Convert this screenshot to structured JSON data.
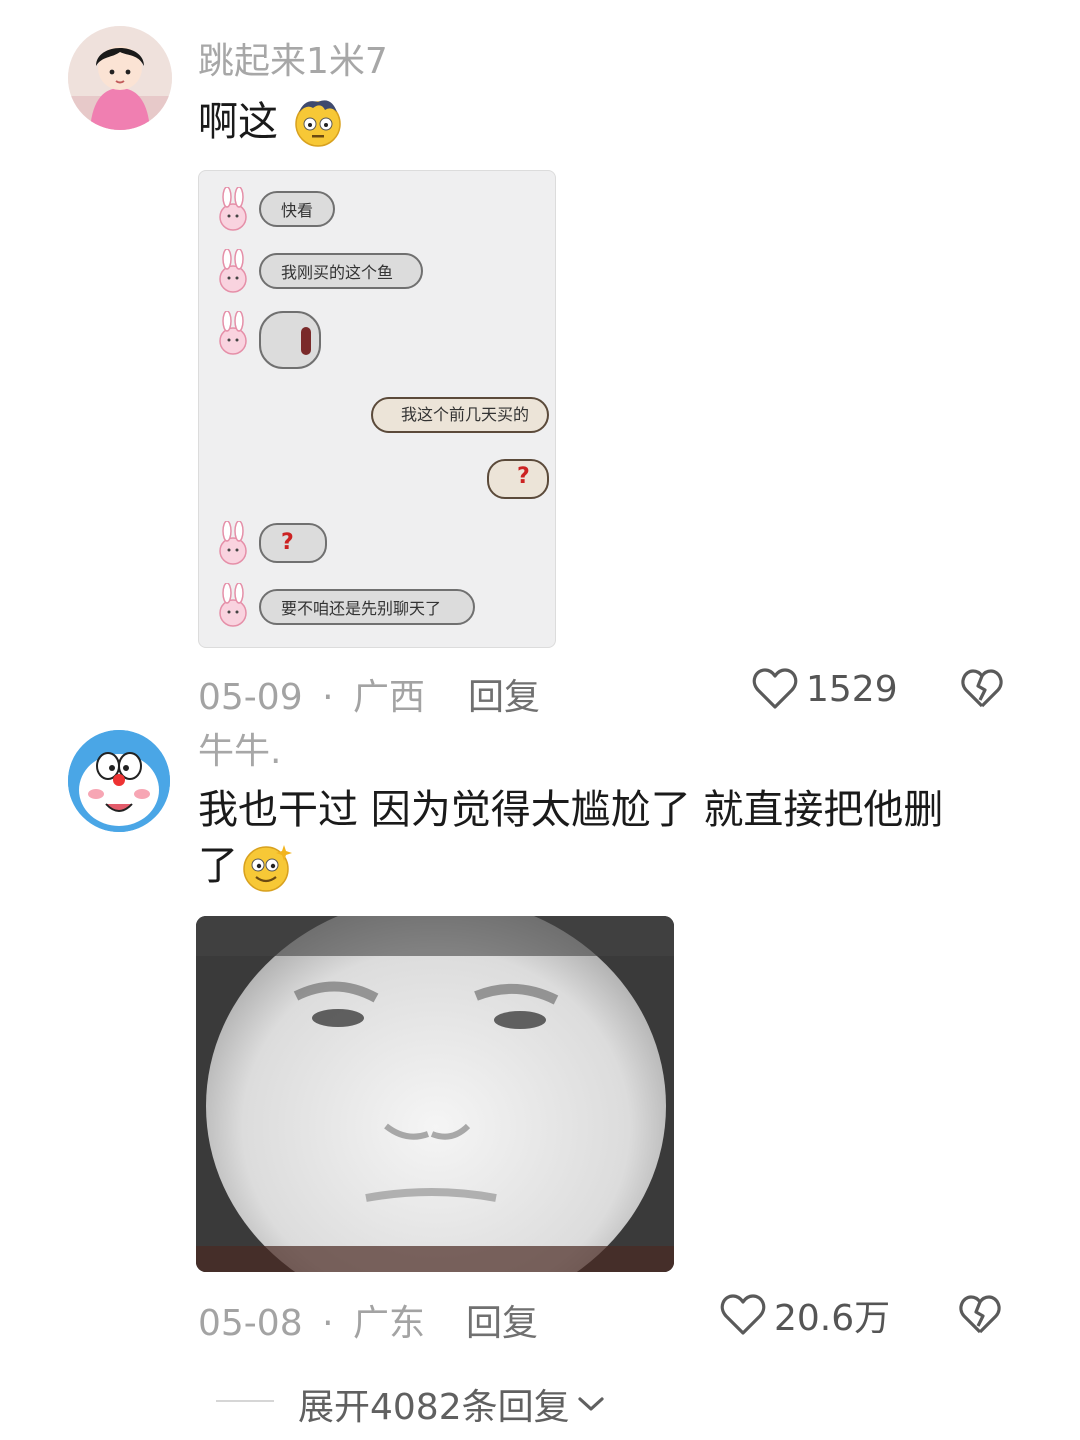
{
  "comments": [
    {
      "username": "跳起来1米7",
      "text": "啊这",
      "emoji": "dizzy-face-emoji",
      "date": "05-09",
      "location": "广西",
      "reply_label": "回复",
      "likes": "1529",
      "chat_image": {
        "messages": [
          {
            "side": "left",
            "text": "快看"
          },
          {
            "side": "left",
            "text": "我刚买的这个鱼"
          },
          {
            "side": "left",
            "text": ""
          },
          {
            "side": "right",
            "text": "我这个前几天买的"
          },
          {
            "side": "right",
            "text": "?"
          },
          {
            "side": "left",
            "text": "?"
          },
          {
            "side": "left",
            "text": "要不咱还是先别聊天了"
          }
        ]
      }
    },
    {
      "username": "牛牛.",
      "text_line1": "我也干过 因为觉得太尴尬了 就直接把他删",
      "text_line2": "了",
      "emoji": "sparkle-eyes-emoji",
      "date": "05-08",
      "location": "广东",
      "reply_label": "回复",
      "likes": "20.6万"
    }
  ],
  "separator": "·",
  "expand_replies": "展开4082条回复"
}
